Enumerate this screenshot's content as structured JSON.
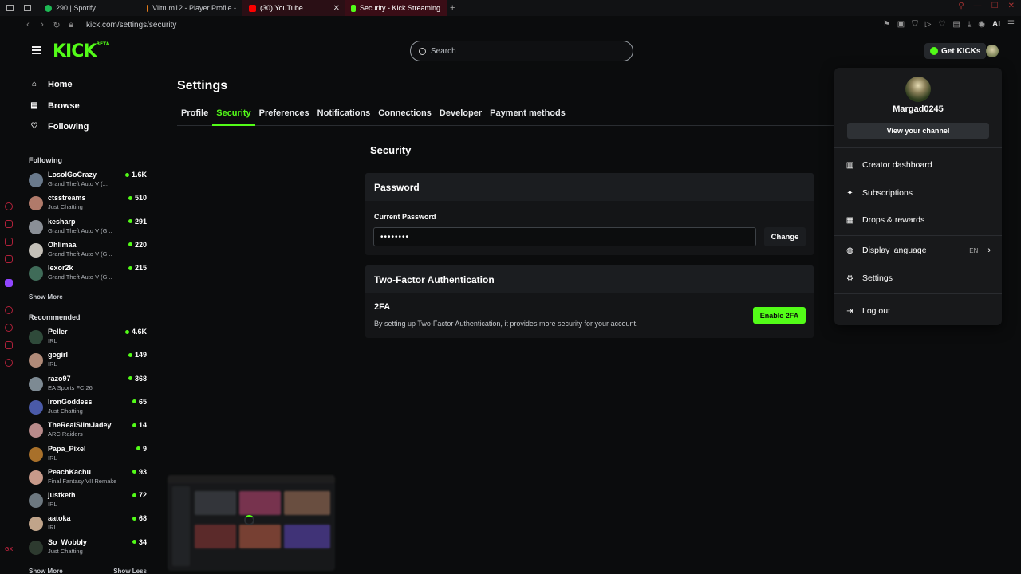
{
  "browser": {
    "tabs": [
      {
        "label": "290 | Spotify",
        "color": "#1db954"
      },
      {
        "label": "Viltrum12 - Player Profile -",
        "color": "#e07a1a"
      },
      {
        "label": "(30) YouTube",
        "color": "#ff0000"
      },
      {
        "label": "Security - Kick Streaming",
        "color": "#53fc18"
      }
    ],
    "url": "kick.com/settings/security"
  },
  "header": {
    "logo": "KICK",
    "logo_tag": "BETA",
    "search_placeholder": "Search",
    "get_kicks": "Get KICKs"
  },
  "sidebar": {
    "nav": [
      {
        "label": "Home",
        "icon": "home-icon"
      },
      {
        "label": "Browse",
        "icon": "browse-icon"
      },
      {
        "label": "Following",
        "icon": "heart-icon"
      }
    ],
    "following_title": "Following",
    "following": [
      {
        "name": "LosolGoCrazy",
        "game": "Grand Theft Auto V (...",
        "viewers": "1.6K",
        "color": "#6a7a8c"
      },
      {
        "name": "ctsstreams",
        "game": "Just Chatting",
        "viewers": "510",
        "color": "#b07a6a"
      },
      {
        "name": "kesharp",
        "game": "Grand Theft Auto V (G...",
        "viewers": "291",
        "color": "#8a8f96"
      },
      {
        "name": "Ohlimaa",
        "game": "Grand Theft Auto V (G...",
        "viewers": "220",
        "color": "#c4c0b8"
      },
      {
        "name": "lexor2k",
        "game": "Grand Theft Auto V (G...",
        "viewers": "215",
        "color": "#3f6b58"
      }
    ],
    "show_more_1": "Show More",
    "recommended_title": "Recommended",
    "recommended": [
      {
        "name": "Peller",
        "game": "IRL",
        "viewers": "4.6K",
        "color": "#2f4a3a"
      },
      {
        "name": "gogirl",
        "game": "IRL",
        "viewers": "149",
        "color": "#b08a78"
      },
      {
        "name": "razo97",
        "game": "EA Sports FC 26",
        "viewers": "368",
        "color": "#7d8a93"
      },
      {
        "name": "IronGoddess",
        "game": "Just Chatting",
        "viewers": "65",
        "color": "#4a5aa8"
      },
      {
        "name": "TheRealSlimJadey",
        "game": "ARC Raiders",
        "viewers": "14",
        "color": "#b88a8a"
      },
      {
        "name": "Papa_Pixel",
        "game": "IRL",
        "viewers": "9",
        "color": "#a8702a"
      },
      {
        "name": "PeachKachu",
        "game": "Final Fantasy VII Remake",
        "viewers": "93",
        "color": "#c89a8a"
      },
      {
        "name": "justketh",
        "game": "IRL",
        "viewers": "72",
        "color": "#6d7880"
      },
      {
        "name": "aatoka",
        "game": "IRL",
        "viewers": "68",
        "color": "#c0a48a"
      },
      {
        "name": "So_Wobbly",
        "game": "Just Chatting",
        "viewers": "34",
        "color": "#2d3a2f"
      }
    ],
    "show_more_2": "Show More",
    "show_less": "Show Less"
  },
  "main": {
    "title": "Settings",
    "tabs": [
      "Profile",
      "Security",
      "Preferences",
      "Notifications",
      "Connections",
      "Developer",
      "Payment methods"
    ],
    "active_tab": "Security",
    "section_title": "Security",
    "password": {
      "title": "Password",
      "label": "Current Password",
      "value": "••••••••",
      "change": "Change"
    },
    "tfa": {
      "title": "Two-Factor Authentication",
      "label": "2FA",
      "description": "By setting up Two-Factor Authentication, it provides more security for your account.",
      "button": "Enable 2FA"
    }
  },
  "dropdown": {
    "username": "Margad0245",
    "view_channel": "View your channel",
    "items": [
      {
        "label": "Creator dashboard",
        "icon": "dashboard-icon"
      },
      {
        "label": "Subscriptions",
        "icon": "sparkle-icon"
      },
      {
        "label": "Drops & rewards",
        "icon": "gift-icon"
      },
      {
        "label": "Display language",
        "icon": "globe-icon",
        "meta": "EN"
      },
      {
        "label": "Settings",
        "icon": "gear-icon"
      },
      {
        "label": "Log out",
        "icon": "logout-icon"
      }
    ]
  },
  "colors": {
    "accent": "#53fc18",
    "background": "#0b0c0d",
    "panel": "#141517"
  }
}
